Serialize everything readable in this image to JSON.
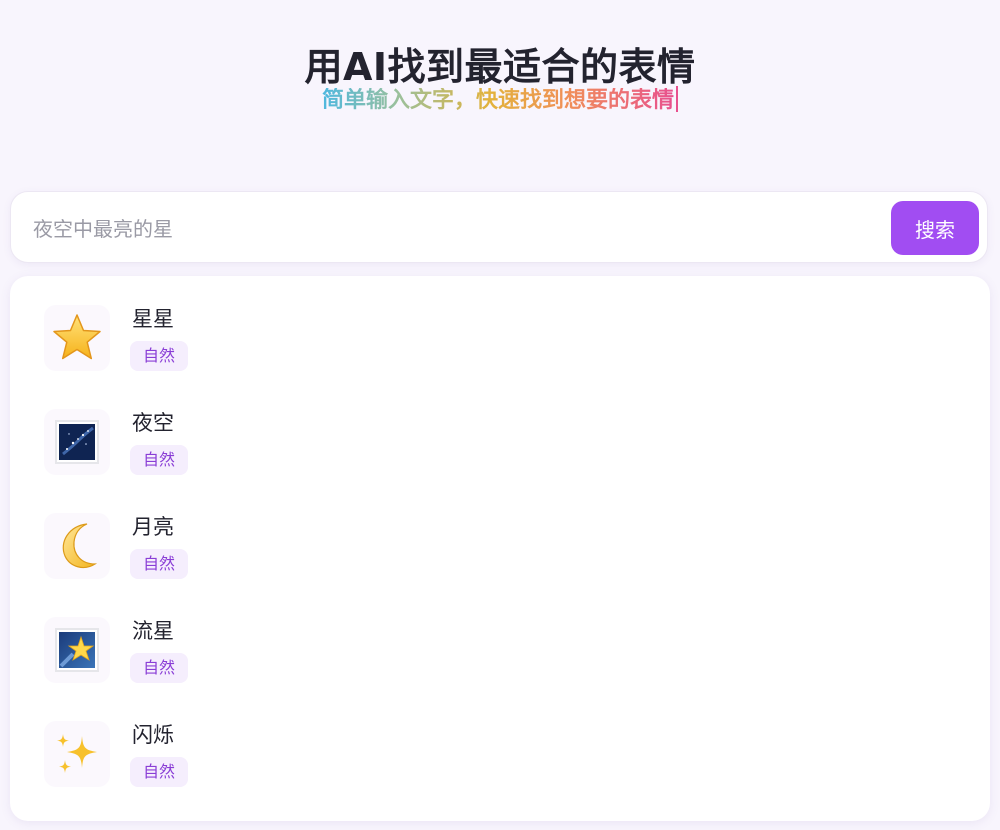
{
  "header": {
    "title": "用AI找到最适合的表情",
    "subtitle": "简单输入文字，快速找到想要的表情"
  },
  "search": {
    "value": "",
    "placeholder": "夜空中最亮的星",
    "button_label": "搜索"
  },
  "results": [
    {
      "name": "星星",
      "tag": "自然",
      "icon": "star-icon"
    },
    {
      "name": "夜空",
      "tag": "自然",
      "icon": "night-sky-icon"
    },
    {
      "name": "月亮",
      "tag": "自然",
      "icon": "crescent-moon-icon"
    },
    {
      "name": "流星",
      "tag": "自然",
      "icon": "shooting-star-icon"
    },
    {
      "name": "闪烁",
      "tag": "自然",
      "icon": "sparkles-icon"
    }
  ],
  "colors": {
    "accent": "#a14df2",
    "tag_bg": "#f5eefd",
    "tag_text": "#8a3ed6"
  }
}
